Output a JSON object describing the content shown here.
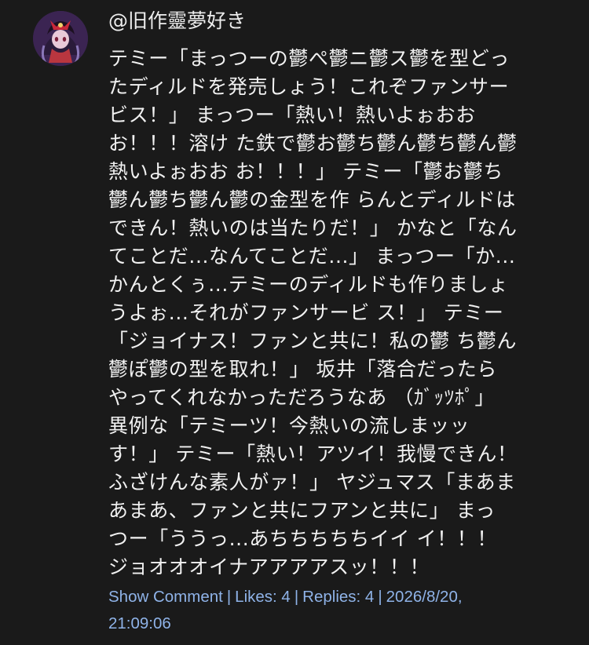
{
  "comment": {
    "author": "@旧作靈夢好き",
    "avatar_icon": "reimu-avatar-icon",
    "lines": [
      "テミー「まっつーの鬱ぺ鬱ニ鬱ス鬱を型どっ",
      "たディルドを発売しょう！これぞファンサー",
      "ビス！」 まっつー「熱い！熱いよぉおお",
      "お！！！溶け た鉄で鬱お鬱ち鬱ん鬱ち鬱ん鬱",
      "熱いよぉおお お！！！」 テミー「鬱お鬱ち",
      "鬱ん鬱ち鬱ん鬱の金型を作 らんとディルドは",
      "できん！熱いのは当たりだ！」 かなと「なん",
      "てことだ...なんてことだ...」 まっつー「か...",
      "かんとくぅ...テミーのディルドも作りましょ",
      "うよぉ...それがファンサービ ス！」 テミー",
      "「ジョイナス！ファンと共に！私の鬱 ち鬱ん",
      "鬱ぽ鬱の型を取れ！」 坂井「落合だったら",
      "やってくれなかっただろうなあ （ｶﾞｯﾂﾎﾟ」",
      "異例な「テミーツ！今熱いの流しまッッ",
      "す！」 テミー「熱い！アツイ！我慢できん！",
      "ふざけんな素人がァ！」 ヤジュマス「まあま",
      "あまあ、ファンと共にフアンと共に」 まっ",
      "つー「ううっ...あちちちちちイイ イ！！！",
      "ジョオオオイナアアアアスッ！！！"
    ],
    "meta": {
      "show_comment": "Show Comment",
      "likes": "Likes: 4",
      "replies": "Replies: 4",
      "date": "2026/8/20,",
      "time": "21:09:06",
      "separator": "|"
    },
    "colors": {
      "background": "#1a1a1a",
      "text": "#f1f1f1",
      "meta_link": "#8fb3e8"
    }
  }
}
